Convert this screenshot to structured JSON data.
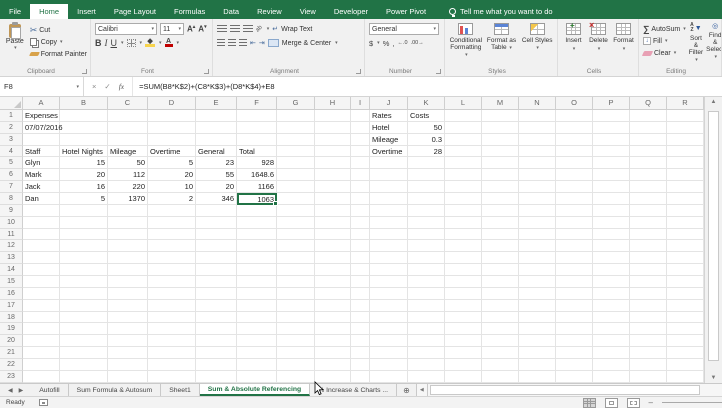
{
  "ribbon": {
    "file_tab": "File",
    "tabs": [
      "Home",
      "Insert",
      "Page Layout",
      "Formulas",
      "Data",
      "Review",
      "View",
      "Developer",
      "Power Pivot"
    ],
    "active_tab": "Home",
    "tell_me": "Tell me what you want to do",
    "groups": {
      "clipboard": {
        "label": "Clipboard",
        "paste": "Paste",
        "cut": "Cut",
        "copy": "Copy",
        "format_painter": "Format Painter"
      },
      "font": {
        "label": "Font",
        "font_name": "Calibri",
        "font_size": "11",
        "bold": "B",
        "italic": "I",
        "underline": "U"
      },
      "alignment": {
        "label": "Alignment",
        "wrap_text": "Wrap Text",
        "merge_center": "Merge & Center"
      },
      "number": {
        "label": "Number",
        "format": "General",
        "currency": "$",
        "percent": "%",
        "comma": ",",
        "inc_dec": "←.0",
        "dec_dec": ".00→"
      },
      "styles": {
        "label": "Styles",
        "items": [
          "Conditional Formatting",
          "Format as Table",
          "Cell Styles"
        ]
      },
      "cells": {
        "label": "Cells",
        "items": [
          "Insert",
          "Delete",
          "Format"
        ]
      },
      "editing": {
        "label": "Editing",
        "autosum": "AutoSum",
        "fill": "Fill",
        "clear": "Clear",
        "sort_filter": "Sort & Filter",
        "find_select": "Find & Select"
      }
    }
  },
  "formula_bar": {
    "name_box": "F8",
    "cancel": "×",
    "enter": "✓",
    "fx": "fx",
    "formula": "=SUM(B8*K$2)+(C8*K$3)+(D8*K$4)+E8"
  },
  "grid": {
    "columns": [
      "A",
      "B",
      "C",
      "D",
      "E",
      "F",
      "G",
      "H",
      "I",
      "J",
      "K",
      "L",
      "M",
      "N",
      "O",
      "P",
      "Q",
      "R"
    ],
    "col_widths": {
      "rowhdr": 23,
      "A": 37,
      "B": 48,
      "C": 40,
      "D": 48,
      "E": 41,
      "F": 40,
      "G": 38,
      "H": 36,
      "I": 19,
      "J": 38,
      "K": 37,
      "L": 37,
      "M": 37,
      "N": 37,
      "O": 37,
      "P": 37,
      "Q": 37,
      "R": 37
    },
    "row_count": 23,
    "selection": "F8",
    "cells": {
      "A1": "Expenses",
      "A2": "07/07/2016",
      "A4": "Staff",
      "B4": "Hotel Nights",
      "C4": "Mileage",
      "D4": "Overtime",
      "E4": "General",
      "F4": "Total",
      "A5": "Glyn",
      "B5": 15,
      "C5": 50,
      "D5": 5,
      "E5": 23,
      "F5": 928,
      "A6": "Mark",
      "B6": 20,
      "C6": 112,
      "D6": 20,
      "E6": 55,
      "F6": 1648.6,
      "A7": "Jack",
      "B7": 16,
      "C7": 220,
      "D7": 10,
      "E7": 20,
      "F7": 1166,
      "A8": "Dan",
      "B8": 5,
      "C8": 1370,
      "D8": 2,
      "E8": 346,
      "F8": 1063,
      "J1": "Rates",
      "K1": "Costs",
      "J2": "Hotel",
      "K2": 50,
      "J3": "Mileage",
      "K3": 0.3,
      "J4": "Overtime",
      "K4": 28
    }
  },
  "sheet_tabs": {
    "tabs": [
      {
        "label": "Autofill",
        "active": false
      },
      {
        "label": "Sum Formula & Autosum",
        "active": false
      },
      {
        "label": "Sheet1",
        "active": false
      },
      {
        "label": "Sum & Absolute Referencing",
        "active": true
      },
      {
        "label": "% Increase & Charts ...",
        "active": false
      }
    ]
  },
  "status_bar": {
    "ready": "Ready",
    "zoom_out": "–"
  },
  "colors": {
    "accent_green": "#217346",
    "grid_line": "#e4e4e4",
    "ribbon_bg": "#f1f1f1"
  }
}
